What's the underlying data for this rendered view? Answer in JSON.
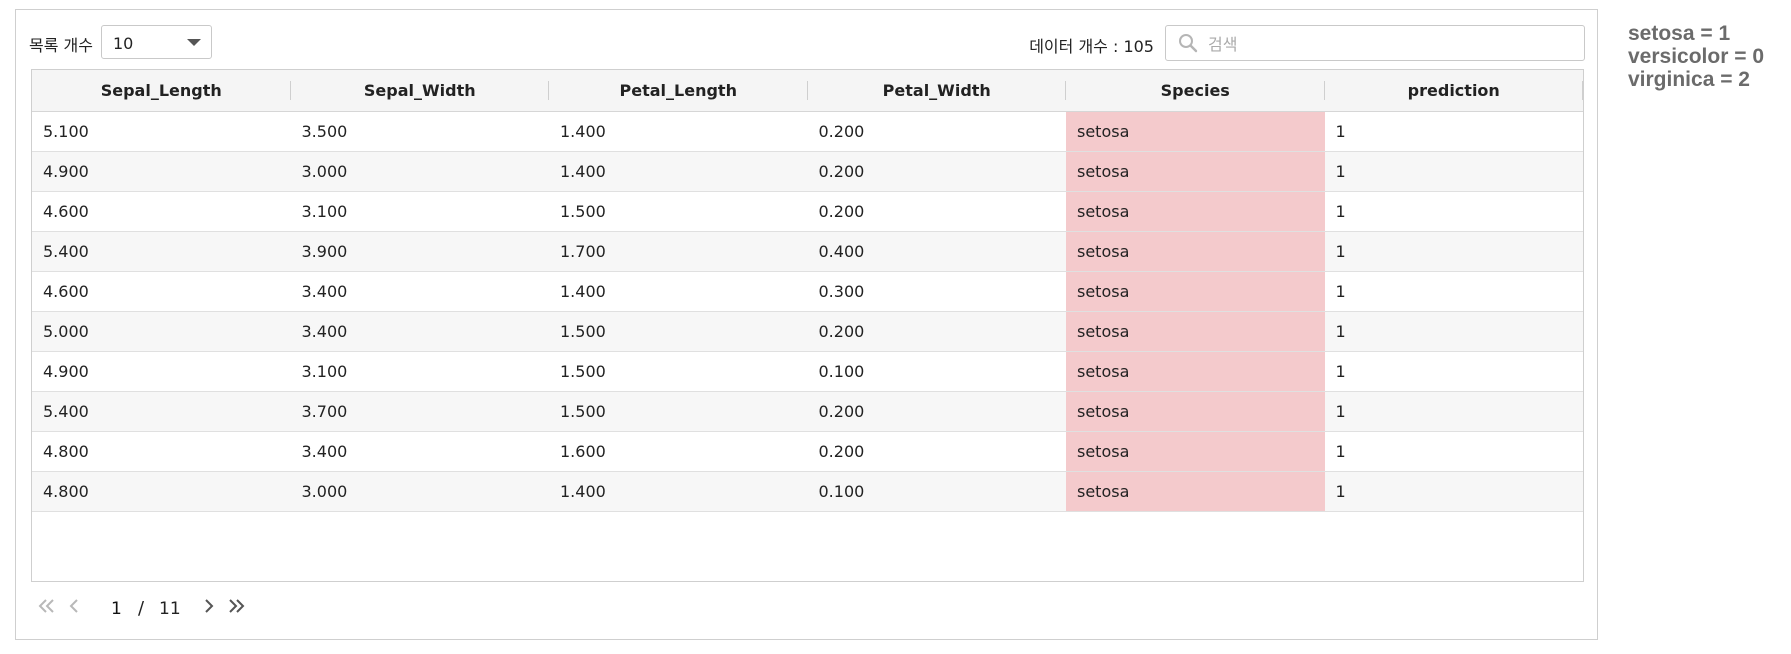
{
  "toolbar": {
    "page_size_label": "목록 개수",
    "page_size_value": "10",
    "data_count_text": "데이터 개수 : 105",
    "search_placeholder": "검색"
  },
  "table": {
    "columns": [
      "Sepal_Length",
      "Sepal_Width",
      "Petal_Length",
      "Petal_Width",
      "Species",
      "prediction"
    ],
    "rows": [
      [
        "5.100",
        "3.500",
        "1.400",
        "0.200",
        "setosa",
        "1"
      ],
      [
        "4.900",
        "3.000",
        "1.400",
        "0.200",
        "setosa",
        "1"
      ],
      [
        "4.600",
        "3.100",
        "1.500",
        "0.200",
        "setosa",
        "1"
      ],
      [
        "5.400",
        "3.900",
        "1.700",
        "0.400",
        "setosa",
        "1"
      ],
      [
        "4.600",
        "3.400",
        "1.400",
        "0.300",
        "setosa",
        "1"
      ],
      [
        "5.000",
        "3.400",
        "1.500",
        "0.200",
        "setosa",
        "1"
      ],
      [
        "4.900",
        "3.100",
        "1.500",
        "0.100",
        "setosa",
        "1"
      ],
      [
        "5.400",
        "3.700",
        "1.500",
        "0.200",
        "setosa",
        "1"
      ],
      [
        "4.800",
        "3.400",
        "1.600",
        "0.200",
        "setosa",
        "1"
      ],
      [
        "4.800",
        "3.000",
        "1.400",
        "0.100",
        "setosa",
        "1"
      ]
    ],
    "species_highlight_color": "#f4cacc"
  },
  "pagination": {
    "current": "1",
    "separator": "/",
    "total": "11"
  },
  "legend": {
    "lines": [
      "setosa = 1",
      "versicolor = 0",
      "virginica = 2"
    ]
  }
}
